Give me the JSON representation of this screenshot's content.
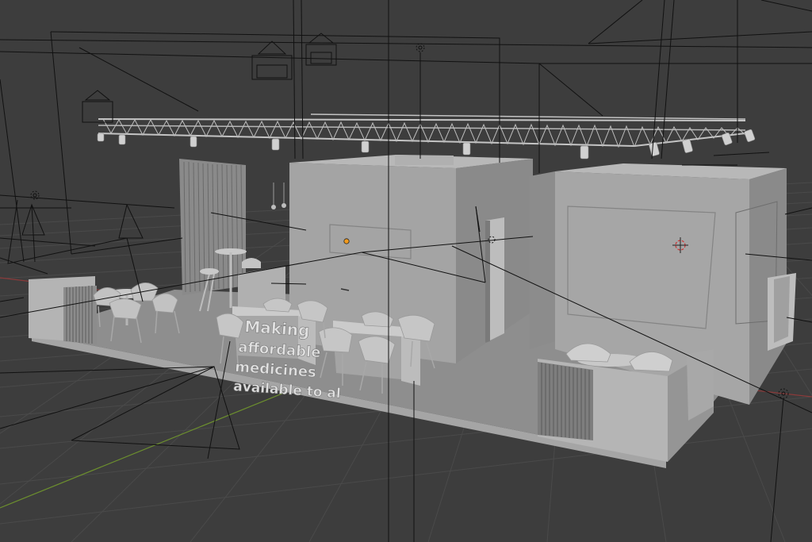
{
  "viewport": {
    "mode": "3d-viewport",
    "background_color": "#3d3d3d",
    "grid_color": "#4a4a4a",
    "x_axis_color": "#8a3a3a",
    "y_axis_color": "#6c8f2e"
  },
  "scene": {
    "booth_color": "#9b9b9b",
    "booth_light": "#a8a8a8",
    "booth_dark": "#7d7d7d",
    "floor_color": "#8e8e8e",
    "wire_color": "#111111",
    "truss_color": "#bdbdbd",
    "origin_color": "#f29b1d",
    "cursor_color": "#cc3333"
  },
  "booth_sign": {
    "lines": [
      "Making",
      "affordable",
      "medicines",
      "available to al"
    ]
  },
  "icons": [
    "camera-icon",
    "light-icon",
    "3d-cursor-icon",
    "object-origin-icon"
  ]
}
